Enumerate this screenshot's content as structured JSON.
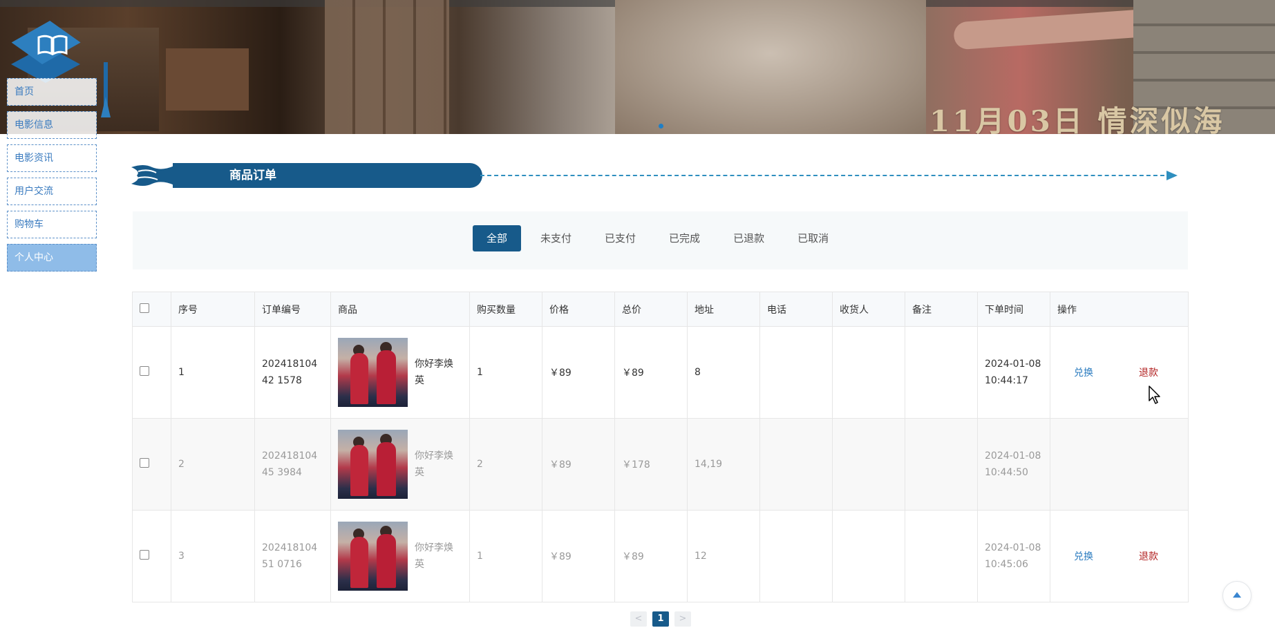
{
  "banner": {
    "caption": "11月03日  情深似海"
  },
  "nav": {
    "items": [
      {
        "label": "首页"
      },
      {
        "label": "电影信息"
      },
      {
        "label": "电影资讯"
      },
      {
        "label": "用户交流"
      },
      {
        "label": "购物车"
      },
      {
        "label": "个人中心"
      }
    ]
  },
  "section": {
    "title": "商品订单"
  },
  "tabs": [
    {
      "label": "全部"
    },
    {
      "label": "未支付"
    },
    {
      "label": "已支付"
    },
    {
      "label": "已完成"
    },
    {
      "label": "已退款"
    },
    {
      "label": "已取消"
    }
  ],
  "table": {
    "headers": [
      "序号",
      "订单编号",
      "商品",
      "购买数量",
      "价格",
      "总价",
      "地址",
      "电话",
      "收货人",
      "备注",
      "下单时间",
      "操作"
    ],
    "rows": [
      {
        "index": "1",
        "order_no": "20241810442 1578",
        "product": "你好李焕英",
        "qty": "1",
        "price": "￥89",
        "total": "￥89",
        "address": "8",
        "phone": "",
        "receiver": "",
        "note": "",
        "time": "2024-01-08 10:44:17",
        "actions": [
          "兑换",
          "退款"
        ]
      },
      {
        "index": "2",
        "order_no": "20241810445 3984",
        "product": "你好李焕英",
        "qty": "2",
        "price": "￥89",
        "total": "￥178",
        "address": "14,19",
        "phone": "",
        "receiver": "",
        "note": "",
        "time": "2024-01-08 10:44:50",
        "actions": []
      },
      {
        "index": "3",
        "order_no": "20241810451 0716",
        "product": "你好李焕英",
        "qty": "1",
        "price": "￥89",
        "total": "￥89",
        "address": "12",
        "phone": "",
        "receiver": "",
        "note": "",
        "time": "2024-01-08 10:45:06",
        "actions": [
          "兑换",
          "退款"
        ]
      }
    ]
  },
  "pager": {
    "prev": "<",
    "current": "1",
    "next": ">"
  }
}
